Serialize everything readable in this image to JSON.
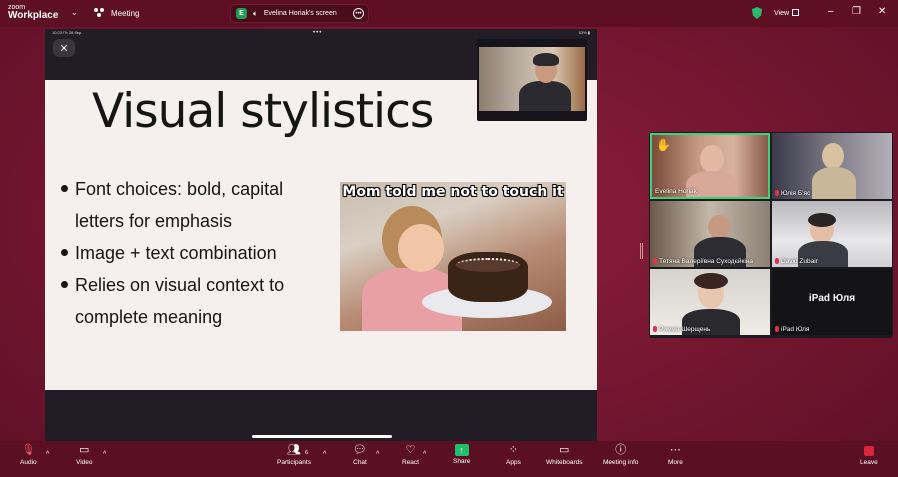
{
  "app": {
    "brand_top": "zoom",
    "brand_bottom": "Workplace",
    "meeting_label": "Meeting"
  },
  "screen_pill": {
    "avatar_letter": "E",
    "label": "Evelina Horiak's screen"
  },
  "view_label": "View",
  "ipad_status": {
    "left": "10:23  Пт 28 бер.",
    "right": "53% ▮"
  },
  "slide": {
    "title": "Visual stylistics",
    "bullets": [
      "Font choices: bold, capital letters for emphasis",
      "Image + text combination",
      "Relies on visual context to complete meaning"
    ],
    "meme_caption": "Mom told me not to touch it"
  },
  "participants": [
    {
      "name": "Evelina Horiak",
      "muted": false,
      "raised_hand": true,
      "active": true
    },
    {
      "name": "Юлія Бʼяс",
      "muted": true
    },
    {
      "name": "Тетяна Валеріївна Суходєйкіна",
      "muted": true
    },
    {
      "name": "David Zubair",
      "muted": true
    },
    {
      "name": "Римма Шерщень",
      "muted": true
    },
    {
      "name": "iPad Юля",
      "muted": true,
      "display_text": "iPad Юля"
    }
  ],
  "toolbar": {
    "audio": "Audio",
    "video": "Video",
    "participants": "Participants",
    "participants_count": "6",
    "chat": "Chat",
    "react": "React",
    "share": "Share",
    "apps": "Apps",
    "whiteboards": "Whiteboards",
    "meeting_info": "Meeting info",
    "more": "More",
    "leave": "Leave"
  },
  "colors": {
    "background": "#7a1a34",
    "toolbar": "#5a0f22",
    "share_green": "#1fbf6a",
    "active_speaker": "#3fd17a",
    "leave_red": "#d9263e"
  }
}
